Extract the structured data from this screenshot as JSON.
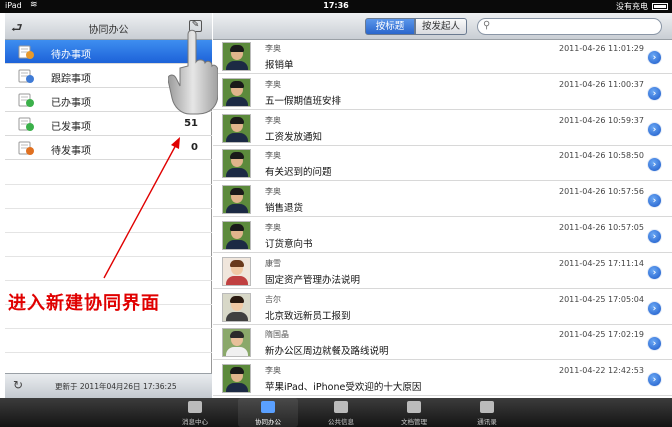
{
  "status_bar": {
    "device": "iPad",
    "time": "17:36",
    "charge": "没有充电"
  },
  "left_pane": {
    "title": "协同办公",
    "menu": [
      {
        "label": "待办事项",
        "count": "",
        "active": true,
        "icon": "pending-folder-icon",
        "icon_color": "#e89a2c"
      },
      {
        "label": "跟踪事项",
        "count": "",
        "active": false,
        "icon": "track-doc-icon",
        "icon_color": "#3f7bd6"
      },
      {
        "label": "已办事项",
        "count": "",
        "active": false,
        "icon": "done-check-icon",
        "icon_color": "#3bb04a"
      },
      {
        "label": "已发事项",
        "count": "51",
        "active": false,
        "icon": "sent-check-icon",
        "icon_color": "#3bb04a"
      },
      {
        "label": "待发事项",
        "count": "0",
        "active": false,
        "icon": "outbox-arrow-icon",
        "icon_color": "#e07020"
      }
    ],
    "updated": "更新于 2011年04月26日 17:36:25"
  },
  "annotation": {
    "text": "进入新建协同界面",
    "color": "#e00000"
  },
  "right_pane": {
    "segments": [
      "按标题",
      "按发起人"
    ],
    "search_placeholder": "",
    "rows": [
      {
        "sender": "李奥",
        "subject": "报销单",
        "time": "2011-04-26 11:01:29",
        "avatar": "male"
      },
      {
        "sender": "李奥",
        "subject": "五一假期值班安排",
        "time": "2011-04-26 11:00:37",
        "avatar": "male"
      },
      {
        "sender": "李奥",
        "subject": "工资发放通知",
        "time": "2011-04-26 10:59:37",
        "avatar": "male"
      },
      {
        "sender": "李奥",
        "subject": "有关迟到的问题",
        "time": "2011-04-26 10:58:50",
        "avatar": "male"
      },
      {
        "sender": "李奥",
        "subject": "销售退货",
        "time": "2011-04-26 10:57:56",
        "avatar": "male"
      },
      {
        "sender": "李奥",
        "subject": "订货意向书",
        "time": "2011-04-26 10:57:05",
        "avatar": "male"
      },
      {
        "sender": "康雪",
        "subject": "固定资产管理办法说明",
        "time": "2011-04-25 17:11:14",
        "avatar": "female"
      },
      {
        "sender": "吉尔",
        "subject": "北京致远新员工报到",
        "time": "2011-04-25 17:05:04",
        "avatar": "female2"
      },
      {
        "sender": "隋国晶",
        "subject": "新办公区周边就餐及路线说明",
        "time": "2011-04-25 17:02:19",
        "avatar": "male2"
      },
      {
        "sender": "李奥",
        "subject": "苹果iPad、iPhone受欢迎的十大原因",
        "time": "2011-04-22 12:42:53",
        "avatar": "male"
      }
    ]
  },
  "tab_bar": {
    "tabs": [
      {
        "label": "消息中心",
        "active": false,
        "icon": "message-icon"
      },
      {
        "label": "协同办公",
        "active": true,
        "icon": "collaboration-icon"
      },
      {
        "label": "公共信息",
        "active": false,
        "icon": "public-info-icon"
      },
      {
        "label": "文档管理",
        "active": false,
        "icon": "document-icon"
      },
      {
        "label": "通讯录",
        "active": false,
        "icon": "contacts-icon"
      }
    ]
  }
}
